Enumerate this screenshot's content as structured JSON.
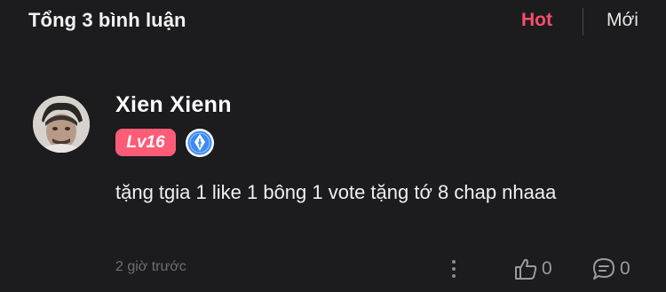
{
  "header": {
    "title": "Tổng 3 bình luận",
    "sort_hot": "Hot",
    "sort_new": "Mới"
  },
  "comment": {
    "username": "Xien Xienn",
    "level": "Lv16",
    "badge_icon": "pen-nib-icon",
    "text": "tặng tgia 1 like 1 bông 1 vote tặng tớ 8 chap nhaaa",
    "time": "2 giờ trước",
    "likes": "0",
    "replies": "0"
  },
  "colors": {
    "background": "#1c1c1e",
    "accent": "#ff4d6b",
    "level_badge": "#ff5c78",
    "muted": "#6e6e72",
    "pen_badge": "#3d8bf2"
  }
}
